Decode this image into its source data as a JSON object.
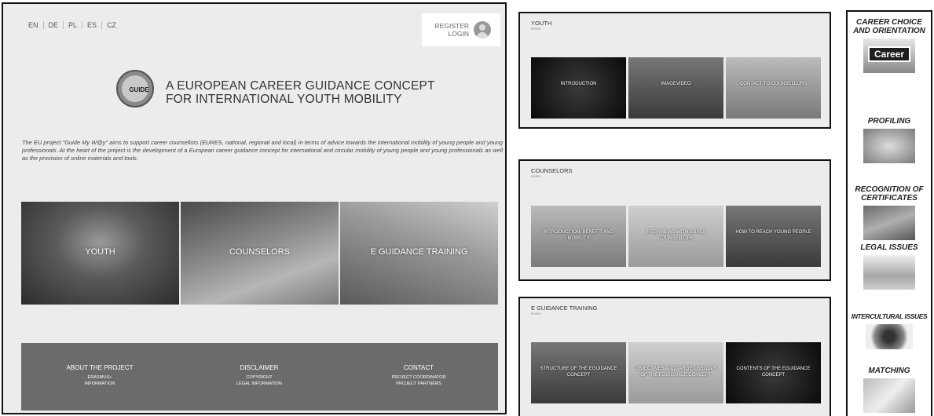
{
  "languages": [
    "EN",
    "DE",
    "PL",
    "ES",
    "CZ"
  ],
  "account": {
    "register": "REGISTER",
    "login": "LOGIN"
  },
  "logo": {
    "text": "GUIDE"
  },
  "hero": {
    "title_line1": "A EUROPEAN CAREER GUIDANCE CONCEPT",
    "title_line2": "FOR INTERNATIONAL YOUTH MOBILITY",
    "intro": "The EU project \"Guide My W@y\" aims to support career counsellors (EURES, national, regional and local) in terms of advice towards the international mobility of young people and young professionals. At the heart of the project is the development of a European career guidance concept for international and circular mobility of young people and young professionals as well as the provision of online materials and tools."
  },
  "main_tiles": [
    "YOUTH",
    "COUNSELORS",
    "E GUIDANCE TRAINING"
  ],
  "footer": {
    "about": {
      "heading": "ABOUT THE PROJECT",
      "links": [
        "ERASMUS+",
        "INFORMATION"
      ]
    },
    "disclaimer": {
      "heading": "DISCLAIMER",
      "links": [
        "COPYRIGHT",
        "LEGAL INFORMATION"
      ]
    },
    "contact": {
      "heading": "CONTACT",
      "links": [
        "PROJECT COORDINATOR",
        "PROJECT PARTNERS"
      ]
    }
  },
  "panels": {
    "youth": {
      "title": "YOUTH",
      "crumb": "Home",
      "tiles": [
        "INTRODUCTION",
        "IMAGEVIDEO",
        "CONTACT TO COUNSELLORS"
      ]
    },
    "counselors": {
      "title": "COUNSELORS",
      "crumb": "Home",
      "tiles": [
        "INTRODUCTION, BENEFIT AND MOBILITY",
        "INTERVIEWS WITH EURES COUNSELLORS",
        "HOW TO REACH YOUNG PEOPLE"
      ]
    },
    "training": {
      "title": "E GUIDANCE TRAINING",
      "crumb": "Home",
      "tiles": [
        "STRUCTURE OF THE EGUIDANCE CONCEPT",
        "OBJECTIVES AND TARGET GROUPS OF THE EGUIDANCE CONCEPT",
        "CONTENTS OF THE EGUIDANCE CONCEPT"
      ]
    }
  },
  "sidebar": {
    "items": [
      {
        "label": "CAREER CHOICE AND ORIENTATION",
        "image_text": "Career"
      },
      {
        "label": "PROFILING"
      },
      {
        "label": "RECOGNITION OF CERTIFICATES"
      },
      {
        "label": "LEGAL ISSUES"
      },
      {
        "label": "INTERCULTURAL ISSUES"
      },
      {
        "label": "MATCHING"
      }
    ]
  }
}
